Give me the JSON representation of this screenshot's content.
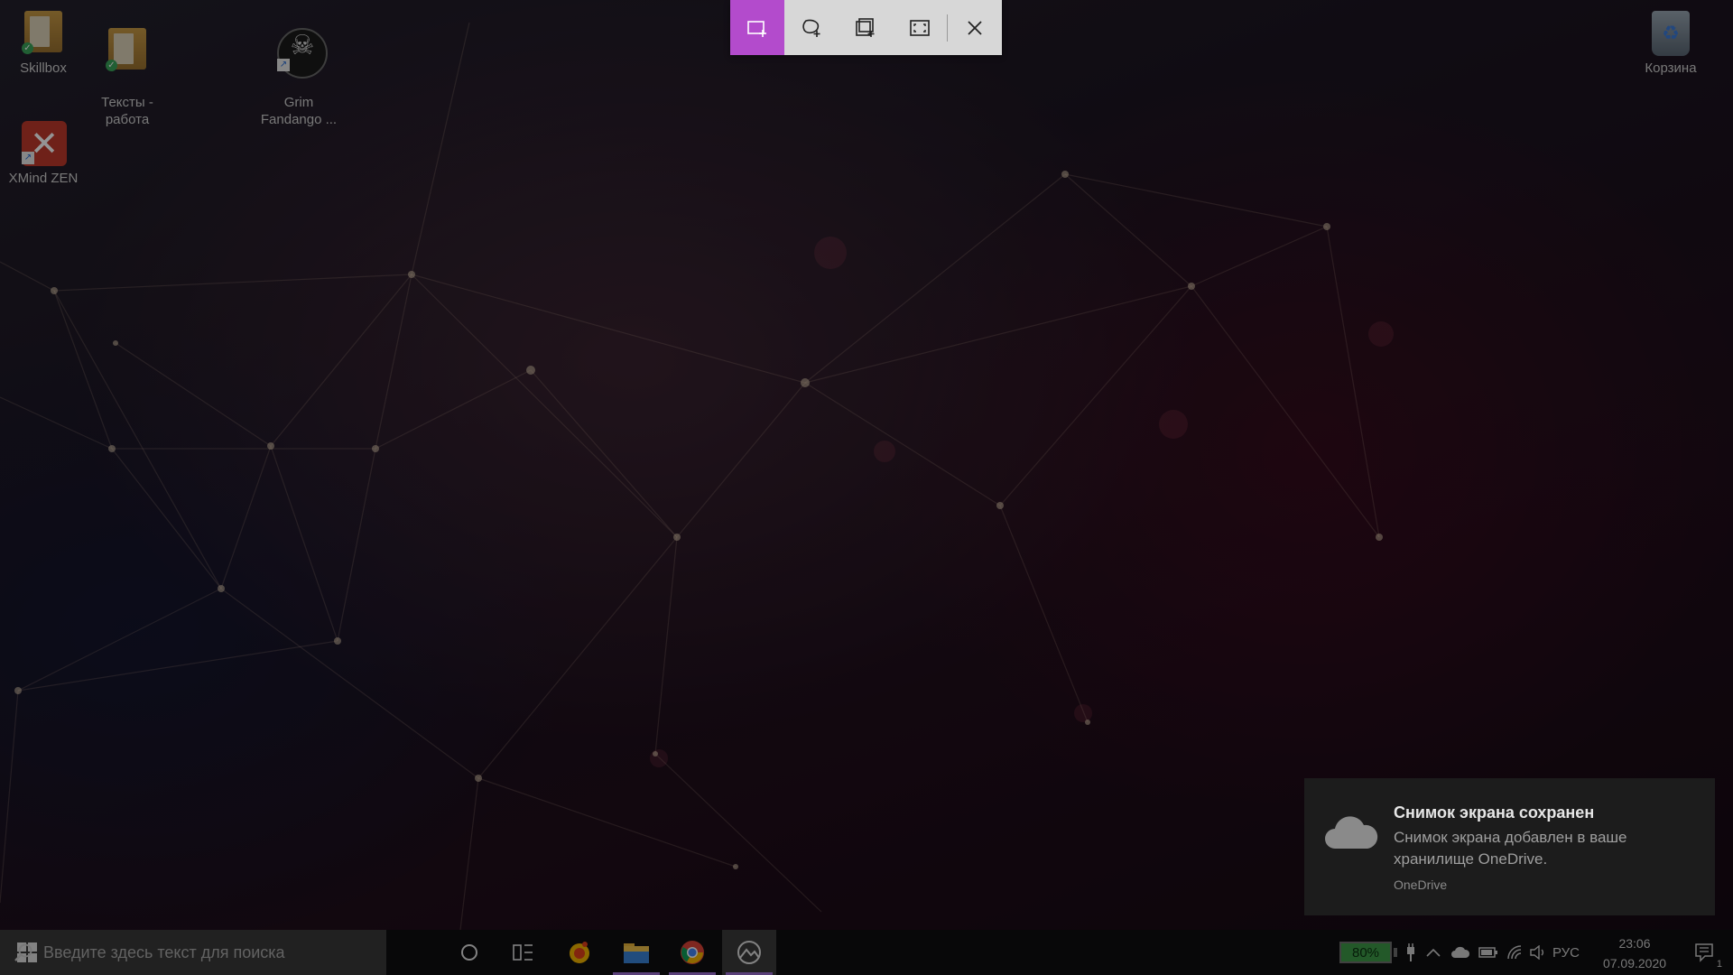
{
  "desktop_icons": [
    {
      "label": "Skillbox"
    },
    {
      "label": "Тексты -\nработа"
    },
    {
      "label": "Grim\nFandango ..."
    },
    {
      "label": "XMind ZEN"
    },
    {
      "label": "Корзина"
    }
  ],
  "snip_toolbar": {
    "modes": [
      "rectangular-snip",
      "freeform-snip",
      "window-snip",
      "fullscreen-snip"
    ],
    "active_mode": "rectangular-snip",
    "accent_color": "#b34bcc"
  },
  "notification": {
    "title": "Снимок экрана сохранен",
    "body": "Снимок экрана добавлен в ваше хранилище OneDrive.",
    "app": "OneDrive"
  },
  "taskbar": {
    "search_placeholder": "Введите здесь текст для поиска",
    "battery_percent": "80%",
    "language": "РУС",
    "time": "23:06",
    "date": "07.09.2020",
    "notification_count": "1"
  }
}
